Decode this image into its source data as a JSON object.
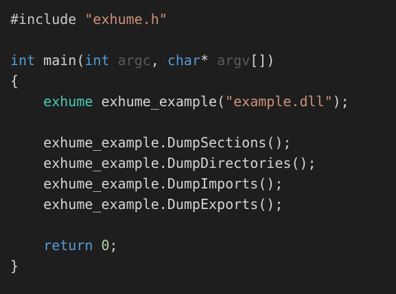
{
  "lines": [
    {
      "t": [
        {
          "c": "pre",
          "v": "#include "
        },
        {
          "c": "str",
          "v": "\"exhume.h\""
        }
      ]
    },
    {
      "t": []
    },
    {
      "t": [
        {
          "c": "kw",
          "v": "int"
        },
        {
          "c": "plain",
          "v": " main("
        },
        {
          "c": "kw",
          "v": "int"
        },
        {
          "c": "plain",
          "v": " "
        },
        {
          "c": "dim",
          "v": "argc"
        },
        {
          "c": "plain",
          "v": ", "
        },
        {
          "c": "kw",
          "v": "char"
        },
        {
          "c": "plain",
          "v": "* "
        },
        {
          "c": "dim",
          "v": "argv"
        },
        {
          "c": "plain",
          "v": "[])"
        }
      ]
    },
    {
      "t": [
        {
          "c": "plain",
          "v": "{"
        }
      ]
    },
    {
      "t": [
        {
          "c": "plain",
          "v": "    "
        },
        {
          "c": "type",
          "v": "exhume"
        },
        {
          "c": "plain",
          "v": " exhume_example("
        },
        {
          "c": "str",
          "v": "\"example.dll\""
        },
        {
          "c": "plain",
          "v": ");"
        }
      ]
    },
    {
      "t": []
    },
    {
      "t": [
        {
          "c": "plain",
          "v": "    exhume_example.DumpSections();"
        }
      ]
    },
    {
      "t": [
        {
          "c": "plain",
          "v": "    exhume_example.DumpDirectories();"
        }
      ]
    },
    {
      "t": [
        {
          "c": "plain",
          "v": "    exhume_example.DumpImports();"
        }
      ]
    },
    {
      "t": [
        {
          "c": "plain",
          "v": "    exhume_example.DumpExports();"
        }
      ]
    },
    {
      "t": []
    },
    {
      "t": [
        {
          "c": "plain",
          "v": "    "
        },
        {
          "c": "kw",
          "v": "return"
        },
        {
          "c": "plain",
          "v": " "
        },
        {
          "c": "num",
          "v": "0"
        },
        {
          "c": "plain",
          "v": ";"
        }
      ]
    },
    {
      "t": [
        {
          "c": "plain",
          "v": "}"
        }
      ]
    }
  ],
  "colors": {
    "background": "#1e1e1e",
    "keyword": "#569cd6",
    "type": "#4ec9b0",
    "string": "#ce9178",
    "number": "#b5cea8",
    "text": "#d4d4d4",
    "unused_param": "#5a5a5a"
  }
}
